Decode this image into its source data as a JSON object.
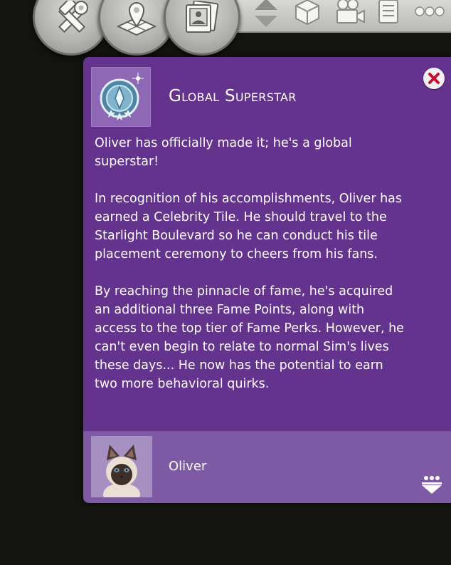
{
  "toolbar": {
    "round_buttons": [
      {
        "name": "build-tools",
        "icon": "hammer-wrench-icon"
      },
      {
        "name": "manage-worlds",
        "icon": "map-pin-icon"
      },
      {
        "name": "gallery",
        "icon": "photo-icon"
      }
    ],
    "strip_icons": [
      "up-down-arrows-icon",
      "cube-icon",
      "camera-icon",
      "list-icon",
      "more-dots-icon"
    ]
  },
  "notification": {
    "title": "Global Superstar",
    "icon": "superstar-badge-icon",
    "close_icon": "close-icon",
    "paragraphs": [
      "Oliver has officially made it; he's a global superstar!",
      "In recognition of his accomplishments, Oliver has earned a Celebrity Tile. He should travel to the Starlight Boulevard so he can conduct his tile placement ceremony to cheers from his fans.",
      "By reaching the pinnacle of fame, he's acquired an additional three Fame Points, along with access to the top tier of Fame Perks. However, he can't even begin to relate to normal Sim's lives these days... He now has the potential to earn two more behavioral quirks."
    ],
    "sim": {
      "name": "Oliver",
      "portrait": "siamese-cat-portrait"
    },
    "more_icon": "more-options-icon"
  },
  "colors": {
    "panel": "#64338e",
    "panel_footer": "#7e5aa5",
    "close_x": "#c8102e",
    "background": "#131310"
  }
}
